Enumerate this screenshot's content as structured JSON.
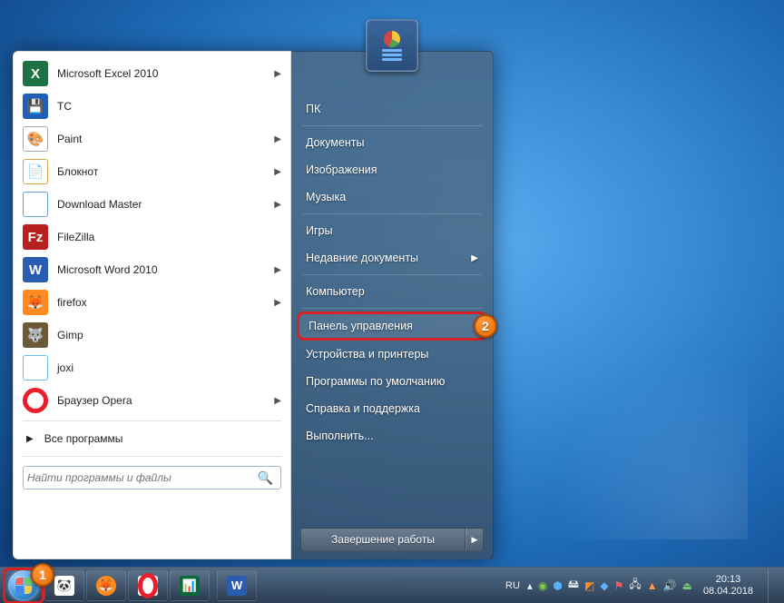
{
  "start_menu": {
    "programs": [
      {
        "label": "Microsoft Excel 2010",
        "icon": "excel",
        "has_submenu": true
      },
      {
        "label": "TC",
        "icon": "tc",
        "has_submenu": false
      },
      {
        "label": "Paint",
        "icon": "paint",
        "has_submenu": true
      },
      {
        "label": "Блокнот",
        "icon": "notepad",
        "has_submenu": true
      },
      {
        "label": "Download Master",
        "icon": "dm",
        "has_submenu": true
      },
      {
        "label": "FileZilla",
        "icon": "fz",
        "has_submenu": false
      },
      {
        "label": "Microsoft Word 2010",
        "icon": "word",
        "has_submenu": true
      },
      {
        "label": "firefox",
        "icon": "ff",
        "has_submenu": true
      },
      {
        "label": "Gimp",
        "icon": "gimp",
        "has_submenu": false
      },
      {
        "label": "joxi",
        "icon": "joxi",
        "has_submenu": false
      },
      {
        "label": "Браузер Opera",
        "icon": "opera",
        "has_submenu": true
      }
    ],
    "all_programs": "Все программы",
    "search_placeholder": "Найти программы и файлы"
  },
  "right_panel": {
    "items": [
      {
        "label": "ПК",
        "sep_after": true
      },
      {
        "label": "Документы"
      },
      {
        "label": "Изображения"
      },
      {
        "label": "Музыка",
        "sep_after": true
      },
      {
        "label": "Игры"
      },
      {
        "label": "Недавние документы",
        "submenu": true,
        "sep_after": true
      },
      {
        "label": "Компьютер",
        "sep_after": true
      },
      {
        "label": "Панель управления",
        "highlight": true,
        "badge": "2"
      },
      {
        "label": "Устройства и принтеры"
      },
      {
        "label": "Программы по умолчанию"
      },
      {
        "label": "Справка и поддержка"
      },
      {
        "label": "Выполнить..."
      }
    ],
    "shutdown": "Завершение работы"
  },
  "taskbar": {
    "lang": "RU",
    "time": "20:13",
    "date": "08.04.2018"
  },
  "annotations": {
    "badge1": "1"
  }
}
